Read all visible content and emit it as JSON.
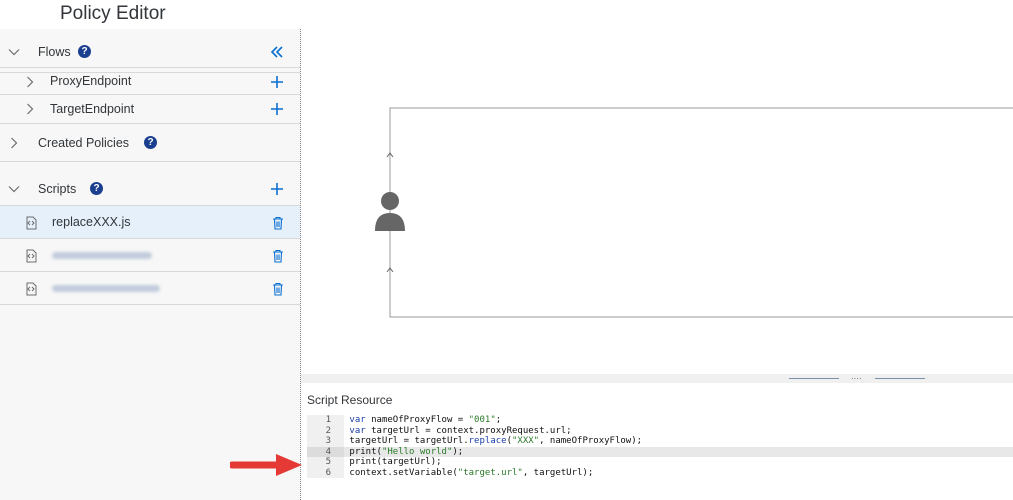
{
  "header": {
    "title": "Policy Editor"
  },
  "sidebar": {
    "flows": {
      "label": "Flows",
      "help": "?",
      "items": [
        {
          "label": "ProxyEndpoint"
        },
        {
          "label": "TargetEndpoint"
        }
      ]
    },
    "created_policies": {
      "label": "Created Policies",
      "help": "?"
    },
    "scripts": {
      "label": "Scripts",
      "help": "?",
      "items": [
        {
          "label": "replaceXXX.js"
        }
      ]
    }
  },
  "editor": {
    "label": "Script Resource",
    "lines": [
      {
        "num": "1",
        "parts": [
          [
            "kw",
            "var"
          ],
          [
            "code",
            " nameOfProxyFlow = "
          ],
          [
            "str",
            "\"001\""
          ],
          [
            "code",
            ";"
          ]
        ]
      },
      {
        "num": "2",
        "parts": [
          [
            "kw",
            "var"
          ],
          [
            "code",
            " targetUrl = context.proxyRequest.url;"
          ]
        ]
      },
      {
        "num": "3",
        "parts": [
          [
            "code",
            "targetUrl = targetUrl."
          ],
          [
            "kw",
            "replace"
          ],
          [
            "code",
            "("
          ],
          [
            "str",
            "\"XXX\""
          ],
          [
            "code",
            ", nameOfProxyFlow);"
          ]
        ]
      },
      {
        "num": "4",
        "parts": [
          [
            "code",
            "print("
          ],
          [
            "str",
            "\"Hello world\""
          ],
          [
            "code",
            ");"
          ]
        ]
      },
      {
        "num": "5",
        "parts": [
          [
            "code",
            "print(targetUrl);"
          ]
        ]
      },
      {
        "num": "6",
        "parts": [
          [
            "code",
            "context.setVariable("
          ],
          [
            "str",
            "\"target.url\""
          ],
          [
            "code",
            ", targetUrl);"
          ]
        ]
      }
    ],
    "active_line": 4
  },
  "colors": {
    "accent": "#0a6ed1",
    "arrow": "#e53935",
    "selected_row": "#e5f0fa",
    "help_badge": "#1b3f8f"
  }
}
